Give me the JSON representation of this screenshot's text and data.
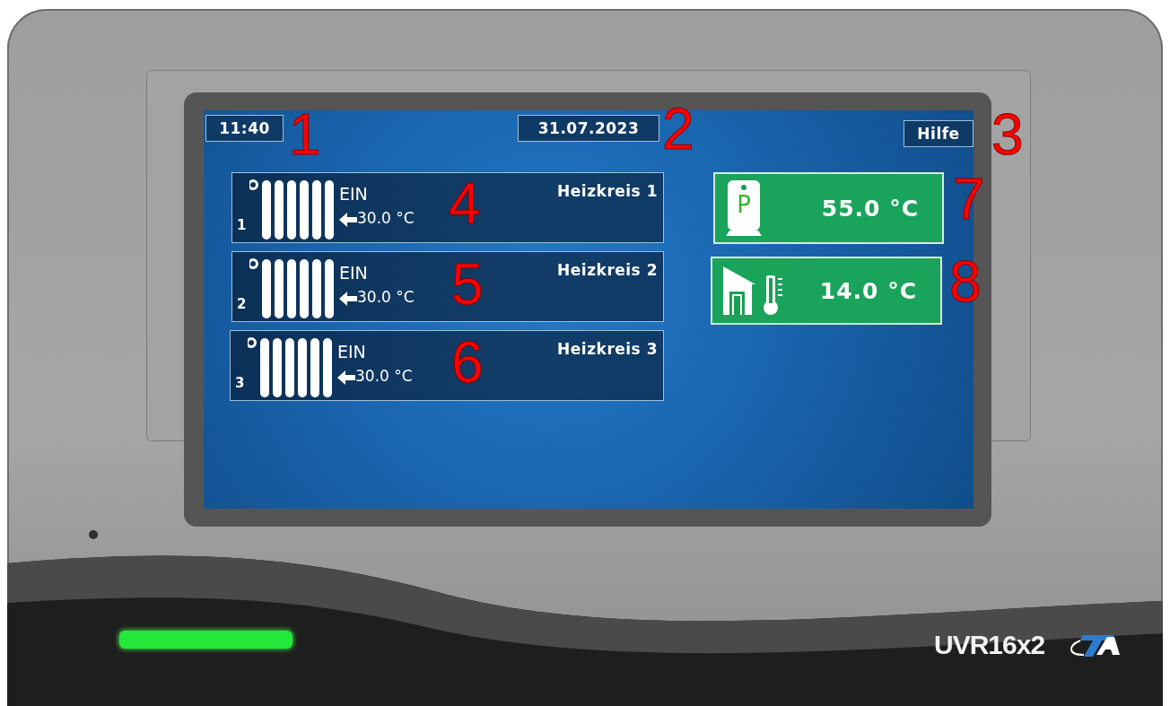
{
  "device": {
    "model": "UVR16x2",
    "led_on": true
  },
  "screen": {
    "time": "11:40",
    "date": "31.07.2023",
    "help_button": "Hilfe",
    "heating_circuits": [
      {
        "number": "1",
        "status": "EIN",
        "temperature": "30.0 °C",
        "name": "Heizkreis 1"
      },
      {
        "number": "2",
        "status": "EIN",
        "temperature": "30.0 °C",
        "name": "Heizkreis 2"
      },
      {
        "number": "3",
        "status": "EIN",
        "temperature": "30.0 °C",
        "name": "Heizkreis 3"
      }
    ],
    "tiles": [
      {
        "kind": "storage",
        "icon_label": "P",
        "value": "55.0 °C"
      },
      {
        "kind": "outdoor",
        "value": "14.0 °C"
      }
    ]
  },
  "callouts": [
    "1",
    "2",
    "3",
    "4",
    "5",
    "6",
    "7",
    "8"
  ]
}
